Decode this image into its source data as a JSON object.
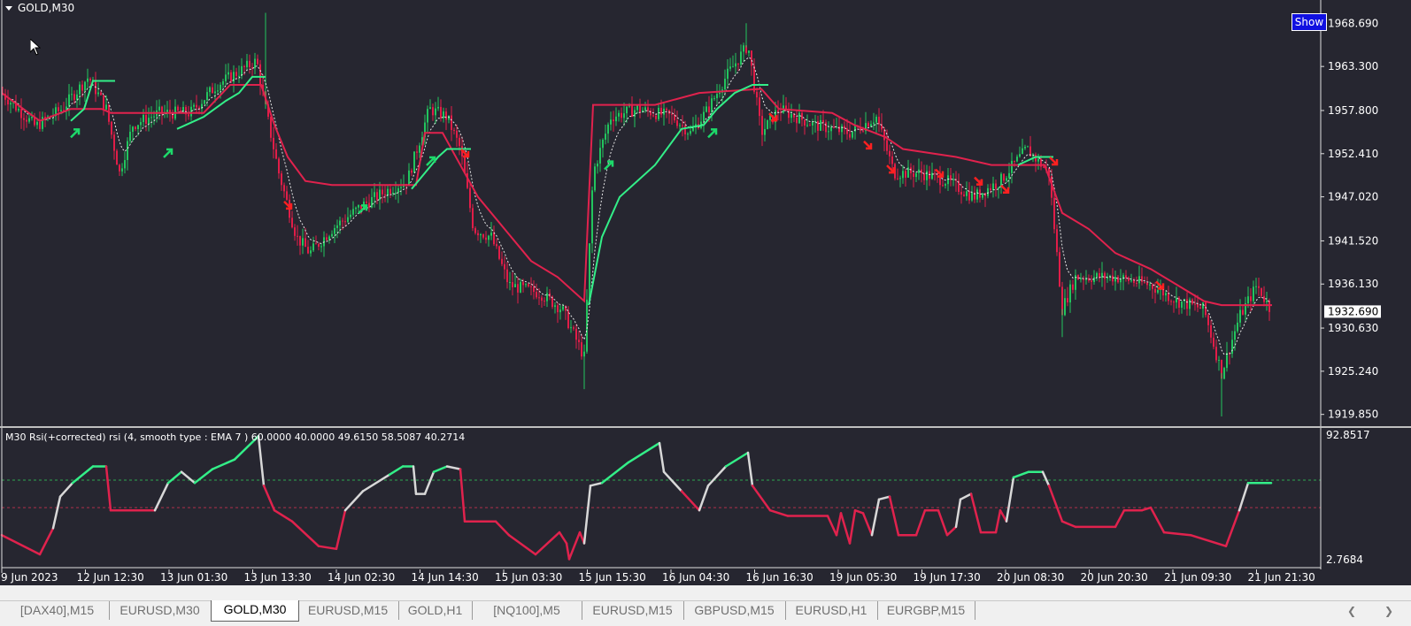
{
  "chart": {
    "symbol_label": "GOLD,M30",
    "show_button": "Show",
    "current_price": "1932.690",
    "price_axis": [
      "1968.690",
      "1963.300",
      "1957.800",
      "1952.410",
      "1947.020",
      "1941.520",
      "1936.130",
      "1930.630",
      "1925.240",
      "1919.850"
    ],
    "price_range": [
      1918.6,
      1971.6
    ],
    "time_axis": [
      "9 Jun 2023",
      "12 Jun 12:30",
      "13 Jun 01:30",
      "13 Jun 13:30",
      "14 Jun 02:30",
      "14 Jun 14:30",
      "15 Jun 03:30",
      "15 Jun 15:30",
      "16 Jun 04:30",
      "16 Jun 16:30",
      "19 Jun 05:30",
      "19 Jun 17:30",
      "20 Jun 08:30",
      "20 Jun 20:30",
      "21 Jun 09:30",
      "21 Jun 21:30"
    ],
    "colors": {
      "background": "#262630",
      "bull": "#22c55e",
      "bear": "#e11d48",
      "signal_up": "#1dd96a",
      "signal_down": "#ff2020",
      "stop_line_up": "#33ee88",
      "stop_line_down": "#e0224d"
    }
  },
  "indicator": {
    "label": "M30 Rsi(+corrected) rsi (4, smooth type : EMA  7 ) 60.0000 40.0000 49.6150 58.5087 40.2714",
    "axis_top": "92.8517",
    "axis_bottom": "2.7684",
    "range": [
      2.7684,
      92.8517
    ],
    "levels": [
      60,
      40
    ],
    "colors": {
      "up": "#33ee88",
      "down": "#e0224d",
      "neutral": "#d8d8d8"
    }
  },
  "tabs": [
    {
      "label": "[DAX40],M15",
      "active": false
    },
    {
      "label": "EURUSD,M30",
      "active": false
    },
    {
      "label": "GOLD,M30",
      "active": true
    },
    {
      "label": "EURUSD,M15",
      "active": false
    },
    {
      "label": "GOLD,H1",
      "active": false
    },
    {
      "label": "[NQ100],M5",
      "active": false
    },
    {
      "label": "EURUSD,M15",
      "active": false
    },
    {
      "label": "GBPUSD,M15",
      "active": false
    },
    {
      "label": "EURUSD,H1",
      "active": false
    },
    {
      "label": "EURGBP,M15",
      "active": false
    }
  ],
  "scroll_icons": {
    "left": "scroll-left-icon",
    "right": "scroll-right-icon"
  }
}
